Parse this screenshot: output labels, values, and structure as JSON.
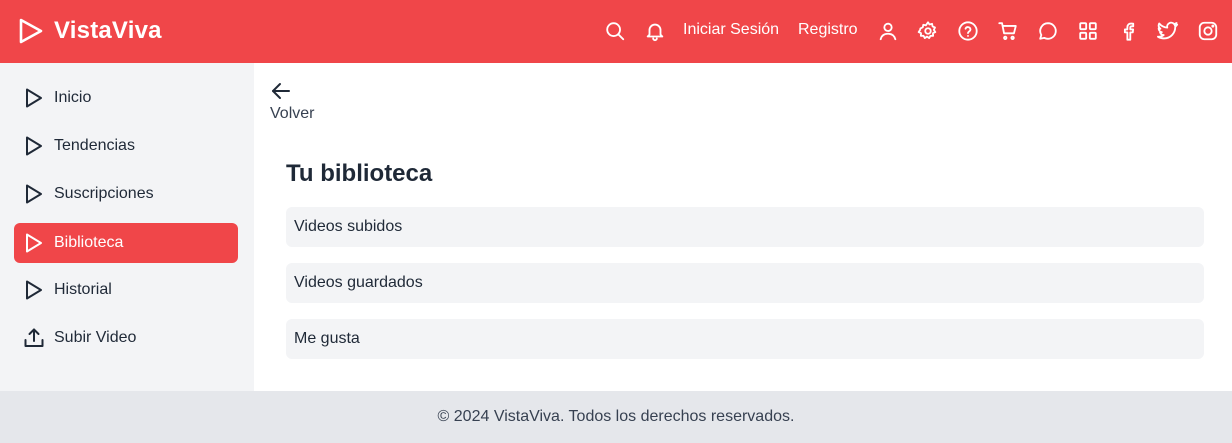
{
  "brand": {
    "name": "VistaViva",
    "logo_icon": "play-icon",
    "color": "#f04649"
  },
  "header": {
    "login_label": "Iniciar Sesión",
    "register_label": "Registro",
    "icons": [
      "search-icon",
      "bell-icon",
      "user-icon",
      "gear-icon",
      "help-icon",
      "cart-icon",
      "chat-icon",
      "grid-icon",
      "facebook-icon",
      "twitter-icon",
      "instagram-icon"
    ]
  },
  "sidebar": {
    "items": [
      {
        "label": "Inicio",
        "icon": "play-icon",
        "active": false
      },
      {
        "label": "Tendencias",
        "icon": "play-icon",
        "active": false
      },
      {
        "label": "Suscripciones",
        "icon": "play-icon",
        "active": false
      },
      {
        "label": "Biblioteca",
        "icon": "play-icon",
        "active": true
      },
      {
        "label": "Historial",
        "icon": "play-icon",
        "active": false
      },
      {
        "label": "Subir Video",
        "icon": "upload-icon",
        "active": false
      }
    ]
  },
  "main": {
    "back_label": "Volver",
    "title": "Tu biblioteca",
    "items": [
      {
        "label": "Videos subidos"
      },
      {
        "label": "Videos guardados"
      },
      {
        "label": "Me gusta"
      }
    ]
  },
  "footer": {
    "text": "© 2024 VistaViva. Todos los derechos reservados."
  }
}
